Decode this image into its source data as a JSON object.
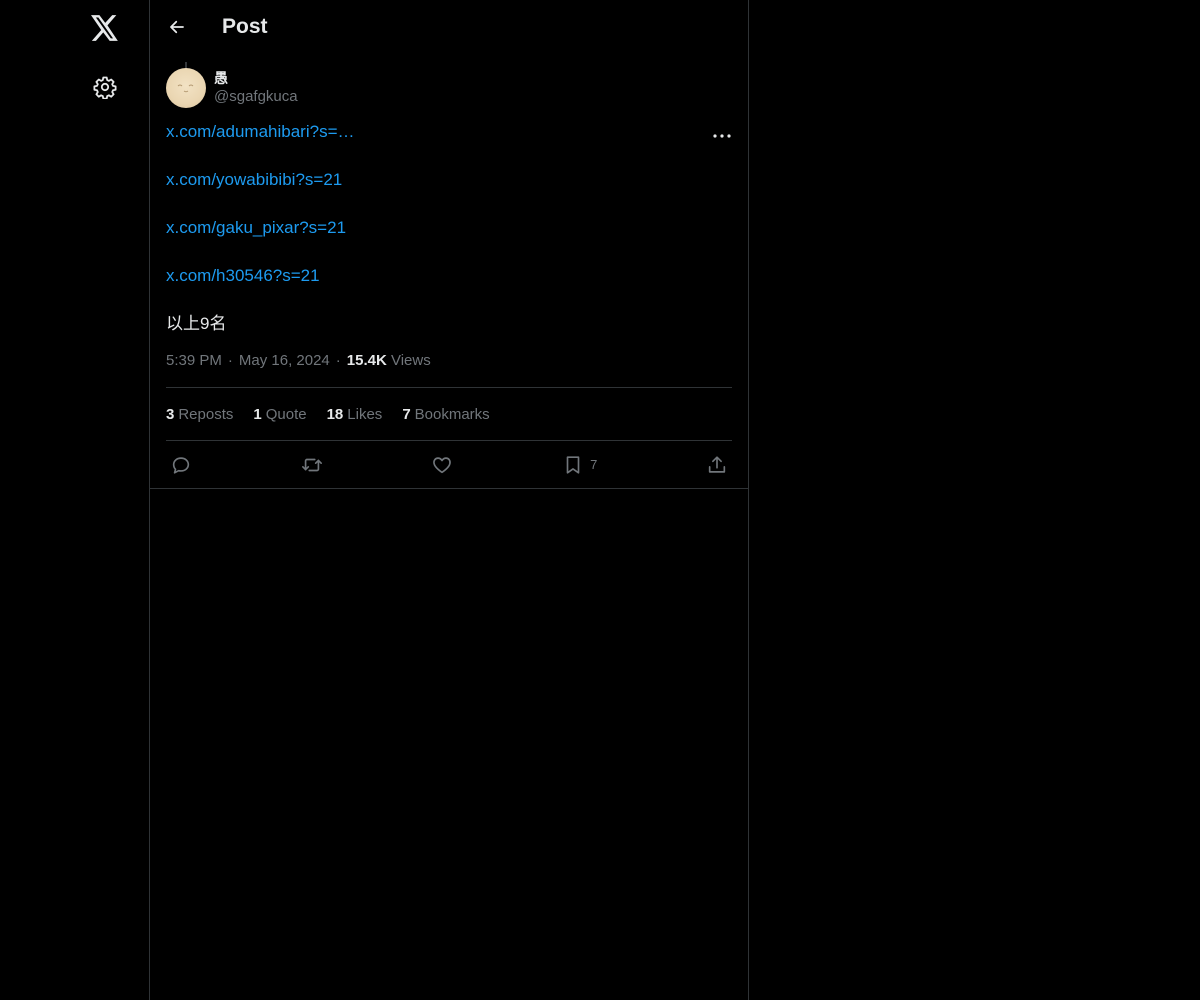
{
  "nav": {
    "logo_icon": "x-logo-icon",
    "settings_icon": "gear-icon"
  },
  "header": {
    "title": "Post",
    "back_icon": "arrow-left-icon"
  },
  "post": {
    "author": {
      "display_name": "愚",
      "handle": "@sgafgkuca"
    },
    "lines": [
      "x.com/adumahibari?s=…",
      "x.com/yowabibibi?s=21",
      "x.com/gaku_pixar?s=21",
      "x.com/h30546?s=21",
      "以上9名"
    ],
    "time": "5:39 PM",
    "date": "May 16, 2024",
    "views_count": "15.4K",
    "views_label": "Views",
    "stats": {
      "reposts_count": "3",
      "reposts_label": "Reposts",
      "quotes_count": "1",
      "quotes_label": "Quote",
      "likes_count": "18",
      "likes_label": "Likes",
      "bookmarks_count": "7",
      "bookmarks_label": "Bookmarks"
    },
    "actions": {
      "bookmark_count": "7"
    }
  },
  "colors": {
    "background": "#000000",
    "link": "#1d9bf0",
    "text": "#e7e9ea",
    "muted": "#71767b",
    "border": "#2f3336"
  }
}
